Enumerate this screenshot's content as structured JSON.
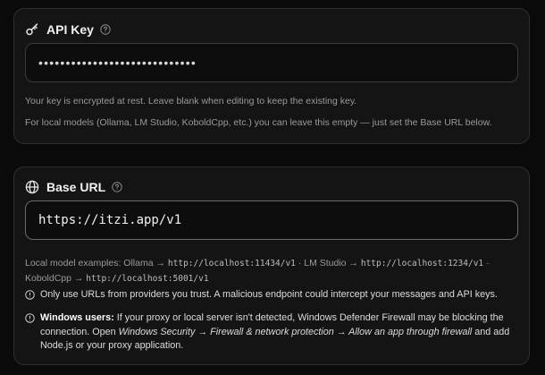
{
  "api_key": {
    "title": "API Key",
    "value_masked": "•••••••••••••••••••••••••••••",
    "hint_encrypted": "Your key is encrypted at rest. Leave blank when editing to keep the existing key.",
    "hint_local": "For local models (Ollama, LM Studio, KoboldCpp, etc.) you can leave this empty — just set the Base URL below."
  },
  "base_url": {
    "title": "Base URL",
    "value": "https://itzi.app/v1",
    "examples": {
      "intro": "Local model examples: Ollama →",
      "ollama_url": "http://localhost:11434/v1",
      "lmstudio_label": "· LM Studio →",
      "lmstudio_url": "http://localhost:1234/v1",
      "sep": "·",
      "kobold_label": "KoboldCpp →",
      "kobold_url": "http://localhost:5001/v1"
    },
    "note_trust": "Only use URLs from providers you trust. A malicious endpoint could intercept your messages and API keys.",
    "note_windows": {
      "bold": "Windows users:",
      "t1": " If your proxy or local server isn't detected, Windows Defender Firewall may be blocking the connection. Open ",
      "i1": "Windows Security → Firewall & network protection → Allow an app through firewall",
      "t2": " and add Node.js or your proxy application."
    }
  },
  "icons": {
    "api_key": "key-icon",
    "base_url": "globe-icon",
    "help": "help-circle-icon",
    "info": "info-circle-icon"
  }
}
